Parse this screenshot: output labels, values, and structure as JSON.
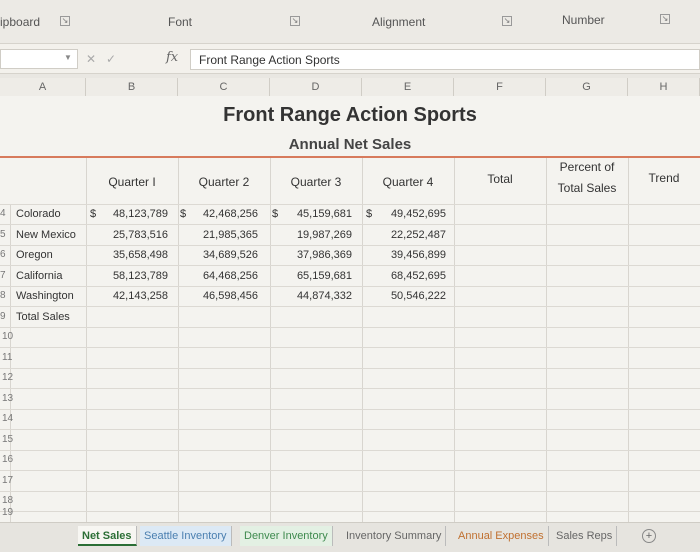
{
  "ribbon": {
    "clipboard": "ipboard",
    "font": "Font",
    "alignment": "Alignment",
    "number": "Number"
  },
  "formula_bar": {
    "fx_label": "fx",
    "content": "Front Range Action Sports"
  },
  "columns": [
    "A",
    "B",
    "C",
    "D",
    "E",
    "F",
    "G",
    "H"
  ],
  "sheet": {
    "title": "Front Range Action Sports",
    "subtitle": "Annual Net Sales",
    "headers": {
      "q1": "Quarter I",
      "q2": "Quarter 2",
      "q3": "Quarter 3",
      "q4": "Quarter 4",
      "total": "Total",
      "percent_line1": "Percent of",
      "percent_line2": "Total Sales",
      "trend": "Trend"
    },
    "rows": [
      {
        "num": "4",
        "state": "Colorado",
        "q1": "48,123,789",
        "q2": "42,468,256",
        "q3": "45,159,681",
        "q4": "49,452,695"
      },
      {
        "num": "5",
        "state": "New Mexico",
        "q1": "25,783,516",
        "q2": "21,985,365",
        "q3": "19,987,269",
        "q4": "22,252,487"
      },
      {
        "num": "6",
        "state": "Oregon",
        "q1": "35,658,498",
        "q2": "34,689,526",
        "q3": "37,986,369",
        "q4": "39,456,899"
      },
      {
        "num": "7",
        "state": "California",
        "q1": "58,123,789",
        "q2": "64,468,256",
        "q3": "65,159,681",
        "q4": "68,452,695"
      },
      {
        "num": "8",
        "state": "Washington",
        "q1": "42,143,258",
        "q2": "46,598,456",
        "q3": "44,874,332",
        "q4": "50,546,222"
      }
    ],
    "dollar_sign": "$",
    "total_row": {
      "num": "9",
      "label": "Total Sales"
    },
    "empty_rows": [
      "10",
      "11",
      "12",
      "13",
      "14",
      "15",
      "16",
      "17",
      "18",
      "19"
    ]
  },
  "tabs": [
    "Net Sales",
    "Seattle Inventory",
    "Denver Inventory",
    "Inventory Summary",
    "Annual Expenses",
    "Sales Reps"
  ],
  "add_sheet_label": "+"
}
